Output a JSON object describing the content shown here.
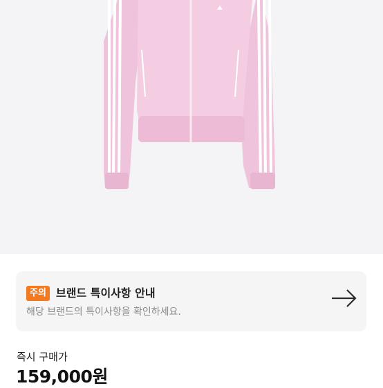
{
  "notice": {
    "badge": "주의",
    "title": "브랜드 특이사항 안내",
    "description": "해당 브랜드의 특이사항을 확인하세요.",
    "arrow_icon": "arrow-right-icon"
  },
  "price": {
    "label": "즉시 구매가",
    "value": "159,000원"
  },
  "colors": {
    "badge": "#f47a22",
    "jacket": "#f2c8df",
    "card_background": "#f5f5f5"
  }
}
